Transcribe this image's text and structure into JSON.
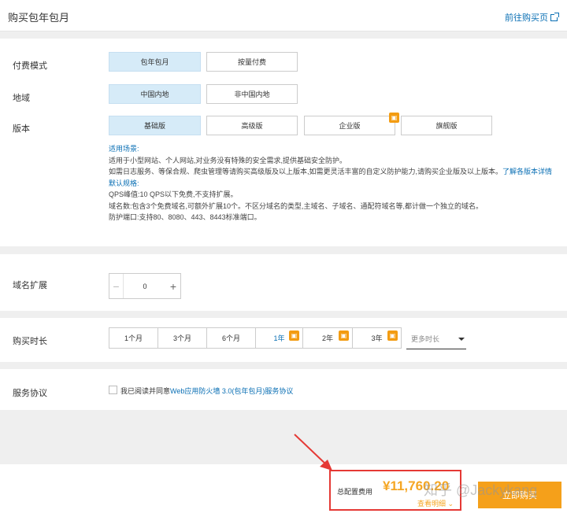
{
  "header": {
    "title": "购买包年包月",
    "link": "前往购买页"
  },
  "billing": {
    "label": "付费模式",
    "options": [
      "包年包月",
      "按量付费"
    ]
  },
  "region": {
    "label": "地域",
    "options": [
      "中国内地",
      "非中国内地"
    ]
  },
  "edition": {
    "label": "版本",
    "options": [
      "基础版",
      "高级版",
      "企业版",
      "旗舰版"
    ]
  },
  "description": {
    "scene_title": "适用场景:",
    "scene_line1": "适用于小型网站、个人网站,对业务没有特殊的安全需求,提供基础安全防护。",
    "scene_line2": "如需日志服务、等保合规、爬虫管理等请购买高级版及以上版本,如需更灵活丰富的自定义防护能力,请购买企业版及以上版本。",
    "scene_link": "了解各版本详情",
    "spec_title": "默认规格:",
    "spec_qps": "QPS峰值:10 QPS以下免费,不支持扩展。",
    "spec_domains": "域名数:包含3个免费域名,可额外扩展10个。不区分域名的类型,主域名、子域名、通配符域名等,都计做一个独立的域名。",
    "spec_ports": "防护端口:支持80、8080、443、8443标准端口。"
  },
  "domain_ext": {
    "label": "域名扩展",
    "value": "0",
    "minus": "−",
    "plus": "+"
  },
  "duration": {
    "label": "购买时长",
    "options": [
      "1个月",
      "3个月",
      "6个月",
      "1年",
      "2年",
      "3年"
    ],
    "more": "更多时长"
  },
  "agreement": {
    "label": "服务协议",
    "text": "我已阅读并同意",
    "link": "Web应用防火墙 3.0(包年包月)服务协议"
  },
  "footer": {
    "total_label": "总配置费用",
    "price": "¥11,760.20",
    "detail": "查看明细",
    "buy": "立即购买"
  },
  "watermark": "知乎 @Jackykang",
  "colors": {
    "accent": "#0a6fb4",
    "selected_bg": "#d6ebf8",
    "price": "#f5a623",
    "badge": "#f39c12",
    "annotation": "#e53935"
  }
}
